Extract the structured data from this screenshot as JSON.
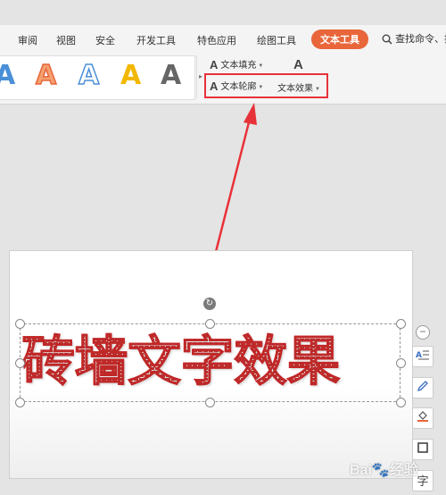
{
  "menubar": {
    "tabs": [
      "审阅",
      "视图",
      "安全",
      "开发工具",
      "特色应用",
      "绘图工具",
      "文本工具"
    ],
    "active_tab": "文本工具",
    "search_label": "查找命令、搜"
  },
  "ribbon": {
    "styles_glyph": "A",
    "text_fill_label": "文本填充",
    "text_outline_label": "文本轮廓",
    "text_effects_label": "文本效果",
    "more_glyph": "A"
  },
  "slide": {
    "art_text": "砖墙文字效果"
  },
  "side_tools": {
    "minus": "−",
    "layout_icon": "layout-options",
    "pen_icon": "pen",
    "fill_icon": "fill-bucket",
    "border_icon": "border-square",
    "text_icon": "字"
  },
  "watermark": "Bai🐾经验",
  "colors": {
    "accent": "#e8663a",
    "highlight_box": "#e8323a",
    "arrow": "#e8323a",
    "brick_red": "#d63a3a"
  }
}
